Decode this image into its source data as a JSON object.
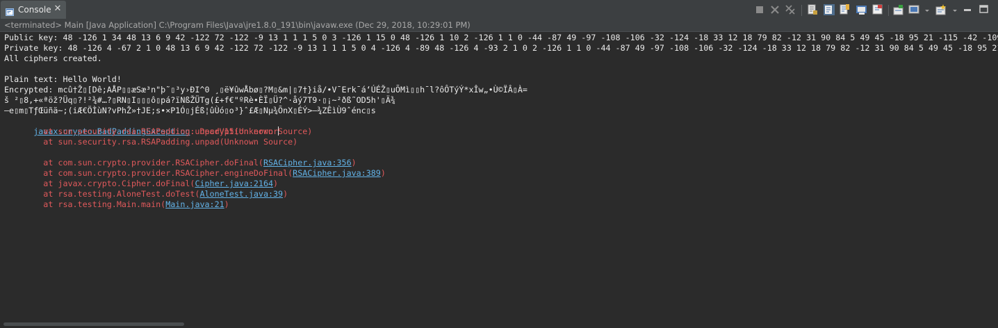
{
  "tab": {
    "label": "Console",
    "close_symbol": "✕",
    "icon": "console-icon"
  },
  "toolbar": {
    "buttons": [
      {
        "name": "terminate-button",
        "icon": "stop-icon"
      },
      {
        "name": "remove-launch-button",
        "icon": "remove-x-icon"
      },
      {
        "name": "remove-all-terminated-button",
        "icon": "remove-all-icon"
      },
      {
        "name": "scroll-lock-button",
        "icon": "scroll-lock-icon"
      },
      {
        "name": "show-stdout-button",
        "icon": "show-stdout-icon"
      },
      {
        "name": "show-stderr-button",
        "icon": "show-stderr-icon"
      },
      {
        "name": "word-wrap-button",
        "icon": "word-wrap-icon"
      },
      {
        "name": "pin-console-button",
        "icon": "pin-icon"
      },
      {
        "name": "open-console-button",
        "icon": "open-console-icon"
      },
      {
        "name": "display-selected-console-button",
        "icon": "display-console-icon"
      },
      {
        "name": "new-console-button",
        "icon": "new-console-icon"
      },
      {
        "name": "minimize-button",
        "icon": "minimize-icon"
      },
      {
        "name": "maximize-button",
        "icon": "maximize-icon"
      }
    ]
  },
  "status": {
    "text": "<terminated> Main [Java Application] C:\\Program Files\\Java\\jre1.8.0_191\\bin\\javaw.exe (Dec 29, 2018, 10:29:01 PM)"
  },
  "console": {
    "line1": "Public key: 48 -126 1 34 48 13 6 9 42 -122 72 -122 -9 13 1 1 1 5 0 3 -126 1 15 0 48 -126 1 10 2 -126 1 1 0 -44 -87 49 -97 -108 -106 -32 -124 -18 33 12 18 79 82 -12 31 90 84 5 49 45 -18 95 21 -115 -42 -109 -",
    "line2": "Private key: 48 -126 4 -67 2 1 0 48 13 6 9 42 -122 72 -122 -9 13 1 1 1 5 0 4 -126 4 -89 48 -126 4 -93 2 1 0 2 -126 1 1 0 -44 -87 49 -97 -108 -106 -32 -124 -18 33 12 18 79 82 -12 31 90 84 5 49 45 -18 95 21 -",
    "line3": "All ciphers created.",
    "line5": "Plain text: Hello World!",
    "line6": "Encrypted: mcû†Ž▯[Dê;AÅP▯▯æSæ³n\"þ˜▯³y›ÐI^0 ¸▯ë¥ûwÅbø▯?M▯&m|▯7†}iå/•V¯Erk¯á‘ÚÉŽ▯uÕMì▯▯h¯l?ôÔTýÝ*xÎw„•Ù©ÏÂ▯À=",
    "line7": "š ²▯8,+«ªöž?Üq▯?!²¾#…?▯RN▯I▯▯▯ô▯pá?ïNßŽÜTg(£+f€\"ºRè•ÈÏ▯Ü?^·åý7T9·▯¡~²ðß˜OD5h'▯Ä¾",
    "line8": "—e▯m▯TƒŒüñä~;(iÆ€ÖÌùN?vPhŽ»†JE;s•×P1Ó▯jÉß¦ûÙó▯o³}ˆ£Æ▯Nµ¾ÕnX▯ÉÝ>—¾ZÊìÙ9ˆénc▯s",
    "exception_class": "javax.crypto.BadPaddingException",
    "exception_message": ": Decryption error",
    "trace1": "\tat sun.security.rsa.RSAPadding.unpadV15(Unknown Source)",
    "trace2": "\tat sun.security.rsa.RSAPadding.unpad(Unknown Source)",
    "trace3_pre": "\tat com.sun.crypto.provider.RSACipher.doFinal(",
    "trace3_link": "RSACipher.java:356",
    "trace4_pre": "\tat com.sun.crypto.provider.RSACipher.engineDoFinal(",
    "trace4_link": "RSACipher.java:389",
    "trace5_pre": "\tat javax.crypto.Cipher.doFinal(",
    "trace5_link": "Cipher.java:2164",
    "trace6_pre": "\tat rsa.testing.AloneTest.doTest(",
    "trace6_link": "AloneTest.java:39",
    "trace7_pre": "\tat rsa.testing.Main.main(",
    "trace7_link": "Main.java:21",
    "close_paren": ")"
  },
  "colors": {
    "background": "#2b2b2b",
    "stdout": "#ebebeb",
    "stderr": "#e0595b",
    "link": "#63b3e8"
  }
}
